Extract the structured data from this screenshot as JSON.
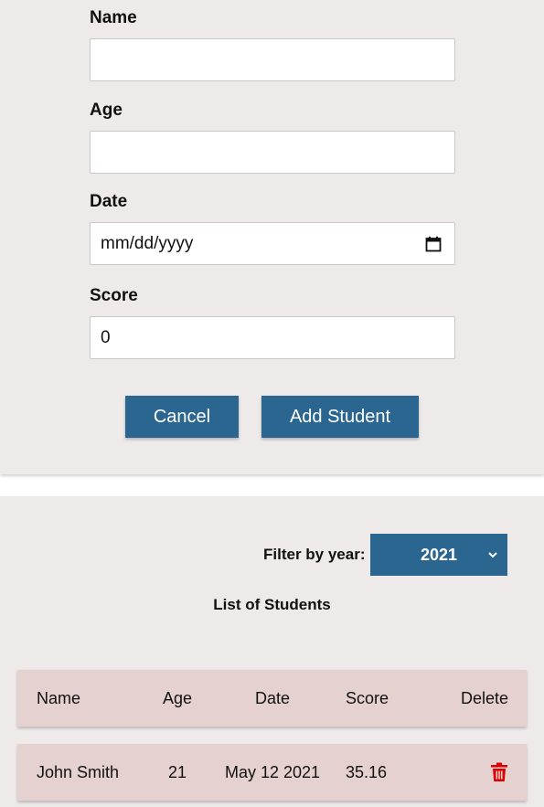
{
  "form": {
    "fields": [
      {
        "label": "Name",
        "value": "",
        "placeholder": ""
      },
      {
        "label": "Age",
        "value": "",
        "placeholder": ""
      },
      {
        "label": "Date",
        "value": "mm/dd/yyyy",
        "placeholder": "mm/dd/yyyy"
      },
      {
        "label": "Score",
        "value": "0",
        "placeholder": ""
      }
    ],
    "cancel_label": "Cancel",
    "submit_label": "Add Student"
  },
  "list": {
    "filter_label": "Filter by year:",
    "filter_selected": "2021",
    "title": "List of Students",
    "columns": [
      "Name",
      "Age",
      "Date",
      "Score",
      "Delete"
    ],
    "rows": [
      {
        "name": "John Smith",
        "age": "21",
        "date": "May 12 2021",
        "score": "35.16"
      }
    ]
  },
  "icons": {
    "date_picker": "calendar-icon",
    "filter_dropdown": "chevron-down-icon",
    "delete": "trash-icon"
  },
  "colors": {
    "primary": "#2b6690",
    "panel_bg": "#eeeae9",
    "row_bg": "#e6d1d1",
    "delete": "#e00000"
  }
}
